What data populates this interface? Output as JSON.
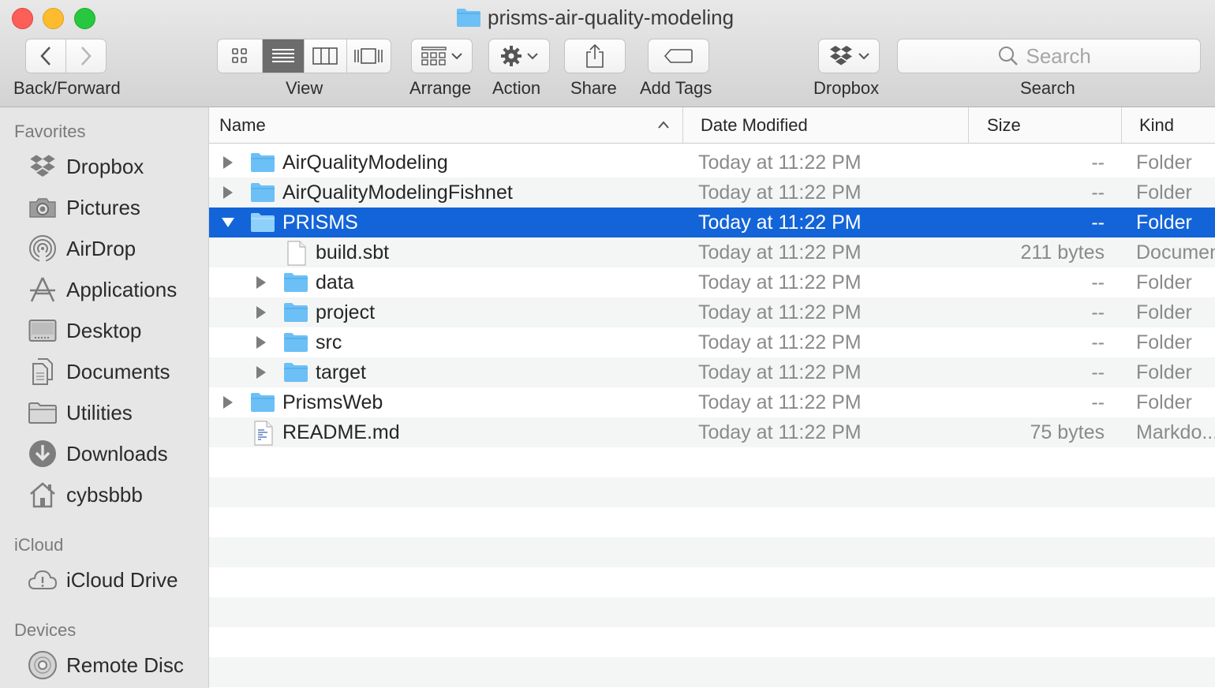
{
  "window": {
    "title": "prisms-air-quality-modeling"
  },
  "toolbar": {
    "back_forward_label": "Back/Forward",
    "view_label": "View",
    "arrange_label": "Arrange",
    "action_label": "Action",
    "share_label": "Share",
    "add_tags_label": "Add Tags",
    "dropbox_label": "Dropbox",
    "search_label": "Search",
    "search_placeholder": "Search",
    "view_modes": [
      "icon-view-icon",
      "list-view-icon",
      "column-view-icon",
      "cover-flow-icon"
    ],
    "selected_view": "list-view-icon"
  },
  "sidebar": {
    "sections": [
      {
        "heading": "Favorites",
        "items": [
          {
            "label": "Dropbox",
            "icon": "dropbox-icon"
          },
          {
            "label": "Pictures",
            "icon": "camera-icon"
          },
          {
            "label": "AirDrop",
            "icon": "airdrop-icon"
          },
          {
            "label": "Applications",
            "icon": "applications-icon"
          },
          {
            "label": "Desktop",
            "icon": "desktop-icon"
          },
          {
            "label": "Documents",
            "icon": "documents-icon"
          },
          {
            "label": "Utilities",
            "icon": "folder-icon"
          },
          {
            "label": "Downloads",
            "icon": "download-icon"
          },
          {
            "label": "cybsbbb",
            "icon": "home-icon"
          }
        ]
      },
      {
        "heading": "iCloud",
        "items": [
          {
            "label": "iCloud Drive",
            "icon": "cloud-icon"
          }
        ]
      },
      {
        "heading": "Devices",
        "items": [
          {
            "label": "Remote Disc",
            "icon": "disc-icon"
          }
        ]
      }
    ]
  },
  "columns": {
    "name": "Name",
    "date": "Date Modified",
    "size": "Size",
    "kind": "Kind",
    "sort_indicator": "ascending"
  },
  "rows": [
    {
      "name": "AirQualityModeling",
      "date": "Today at 11:22 PM",
      "size": "--",
      "kind": "Folder",
      "type": "folder",
      "depth": 0,
      "expanded": false,
      "selected": false
    },
    {
      "name": "AirQualityModelingFishnet",
      "date": "Today at 11:22 PM",
      "size": "--",
      "kind": "Folder",
      "type": "folder",
      "depth": 0,
      "expanded": false,
      "selected": false
    },
    {
      "name": "PRISMS",
      "date": "Today at 11:22 PM",
      "size": "--",
      "kind": "Folder",
      "type": "folder",
      "depth": 0,
      "expanded": true,
      "selected": true
    },
    {
      "name": "build.sbt",
      "date": "Today at 11:22 PM",
      "size": "211 bytes",
      "kind": "Documen",
      "type": "document",
      "depth": 1,
      "expanded": false,
      "selected": false
    },
    {
      "name": "data",
      "date": "Today at 11:22 PM",
      "size": "--",
      "kind": "Folder",
      "type": "folder",
      "depth": 1,
      "expanded": false,
      "selected": false
    },
    {
      "name": "project",
      "date": "Today at 11:22 PM",
      "size": "--",
      "kind": "Folder",
      "type": "folder",
      "depth": 1,
      "expanded": false,
      "selected": false
    },
    {
      "name": "src",
      "date": "Today at 11:22 PM",
      "size": "--",
      "kind": "Folder",
      "type": "folder",
      "depth": 1,
      "expanded": false,
      "selected": false
    },
    {
      "name": "target",
      "date": "Today at 11:22 PM",
      "size": "--",
      "kind": "Folder",
      "type": "folder",
      "depth": 1,
      "expanded": false,
      "selected": false
    },
    {
      "name": "PrismsWeb",
      "date": "Today at 11:22 PM",
      "size": "--",
      "kind": "Folder",
      "type": "folder",
      "depth": 0,
      "expanded": false,
      "selected": false
    },
    {
      "name": "README.md",
      "date": "Today at 11:22 PM",
      "size": "75 bytes",
      "kind": "Markdo...",
      "type": "markdown",
      "depth": 0,
      "expanded": false,
      "selected": false
    }
  ],
  "colors": {
    "selection": "#1364d8",
    "folder": "#6cc0f5",
    "alt_row": "#f4f5f5",
    "sidebar_bg": "#e6e6e6"
  }
}
